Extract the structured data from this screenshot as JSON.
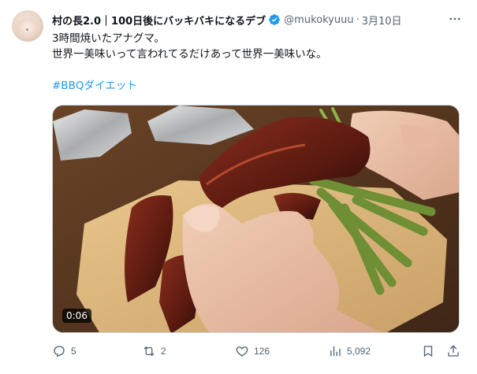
{
  "tweet": {
    "author_name": "村の長2.0｜100日後にバッキバキになるデブ",
    "handle": "@mukokyuuu",
    "separator": "·",
    "date": "3月10日",
    "text_lines": [
      "3時間焼いたアナグマ。",
      "世界一美味いって言われてるだけあって世界一美味いな。"
    ],
    "hashtag": "#BBQダイエット",
    "video": {
      "duration": "0:06",
      "subject": "grilled badger meat held in hand with asparagus on cutting board"
    },
    "stats": {
      "replies": "5",
      "retweets": "2",
      "likes": "126",
      "views": "5,092"
    },
    "icons": {
      "more": "more-icon",
      "verified": "verified-badge-icon",
      "reply": "reply-icon",
      "retweet": "retweet-icon",
      "like": "heart-icon",
      "views": "views-icon",
      "bookmark": "bookmark-icon",
      "share": "share-icon"
    },
    "colors": {
      "accent": "#1d9bf0",
      "text": "#0f1419",
      "secondary": "#536471"
    }
  }
}
